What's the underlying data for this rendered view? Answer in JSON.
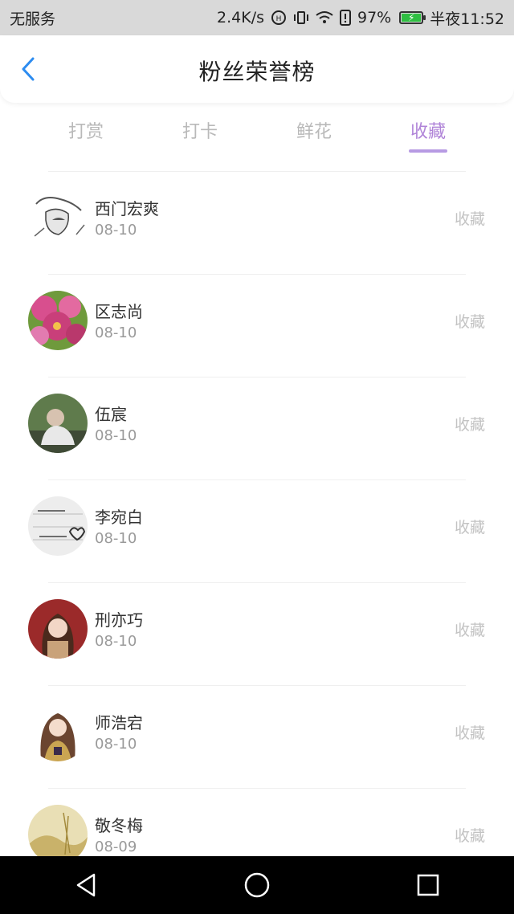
{
  "status_bar": {
    "carrier": "无服务",
    "speed": "2.4K/s",
    "battery": "97%",
    "time": "半夜11:52"
  },
  "header": {
    "title": "粉丝荣誉榜"
  },
  "tabs": [
    {
      "label": "打赏"
    },
    {
      "label": "打卡"
    },
    {
      "label": "鲜花"
    },
    {
      "label": "收藏"
    }
  ],
  "active_tab": "收藏",
  "list": [
    {
      "name": "西门宏爽",
      "date": "08-10",
      "action": "收藏"
    },
    {
      "name": "区志尚",
      "date": "08-10",
      "action": "收藏"
    },
    {
      "name": "伍宸",
      "date": "08-10",
      "action": "收藏"
    },
    {
      "name": "李宛白",
      "date": "08-10",
      "action": "收藏"
    },
    {
      "name": "刑亦巧",
      "date": "08-10",
      "action": "收藏"
    },
    {
      "name": "师浩宕",
      "date": "08-10",
      "action": "收藏"
    },
    {
      "name": "敬冬梅",
      "date": "08-09",
      "action": "收藏"
    }
  ],
  "colors": {
    "accent": "#b084d8",
    "tab_underline": "#b79be3",
    "back_icon": "#2d8cf0",
    "inactive_text": "#b9b9b9"
  },
  "icons": {
    "back": "chevron-left-icon",
    "nav_back": "triangle-back-icon",
    "nav_home": "circle-home-icon",
    "nav_recent": "square-recent-icon"
  }
}
